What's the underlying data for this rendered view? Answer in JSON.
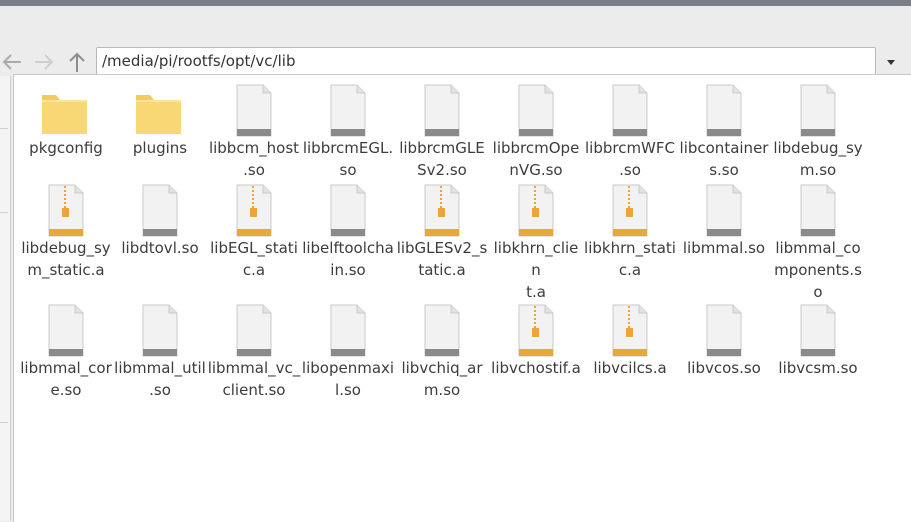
{
  "address": {
    "path": "/media/pi/rootfs/opt/vc/lib"
  },
  "files": [
    {
      "name": "pkgconfig",
      "type": "folder",
      "line1": "pkgconfig",
      "line2": "",
      "line3": ""
    },
    {
      "name": "plugins",
      "type": "folder",
      "line1": "plugins",
      "line2": "",
      "line3": ""
    },
    {
      "name": "libbcm_host.so",
      "type": "doc",
      "line1": "libbcm_host",
      "line2": ".so",
      "line3": ""
    },
    {
      "name": "libbrcmEGL.so",
      "type": "doc",
      "line1": "libbrcmEGL.",
      "line2": "so",
      "line3": ""
    },
    {
      "name": "libbrcmGLESv2.so",
      "type": "doc",
      "line1": "libbrcmGLE",
      "line2": "Sv2.so",
      "line3": ""
    },
    {
      "name": "libbrcmOpenVG.so",
      "type": "doc",
      "line1": "libbrcmOpe",
      "line2": "nVG.so",
      "line3": ""
    },
    {
      "name": "libbrcmWFC.so",
      "type": "doc",
      "line1": "libbrcmWFC",
      "line2": ".so",
      "line3": ""
    },
    {
      "name": "libcontainers.so",
      "type": "doc",
      "line1": "libcontainer",
      "line2": "s.so",
      "line3": ""
    },
    {
      "name": "libdebug_sym.so",
      "type": "doc",
      "line1": "libdebug_sy",
      "line2": "m.so",
      "line3": ""
    },
    {
      "name": "libdebug_sym_static.a",
      "type": "archive",
      "line1": "libdebug_sy",
      "line2": "m_static.a",
      "line3": ""
    },
    {
      "name": "libdtovl.so",
      "type": "doc",
      "line1": "libdtovl.so",
      "line2": "",
      "line3": ""
    },
    {
      "name": "libEGL_static.a",
      "type": "archive",
      "line1": "libEGL_stati",
      "line2": "c.a",
      "line3": ""
    },
    {
      "name": "libelftoolchain.so",
      "type": "doc",
      "line1": "libelftoolcha",
      "line2": "in.so",
      "line3": ""
    },
    {
      "name": "libGLESv2_static.a",
      "type": "archive",
      "line1": "libGLESv2_s",
      "line2": "tatic.a",
      "line3": ""
    },
    {
      "name": "libkhrn_client.a",
      "type": "archive",
      "line1": "libkhrn_clien",
      "line2": "t.a",
      "line3": ""
    },
    {
      "name": "libkhrn_static.a",
      "type": "archive",
      "line1": "libkhrn_stati",
      "line2": "c.a",
      "line3": ""
    },
    {
      "name": "libmmal.so",
      "type": "doc",
      "line1": "libmmal.so",
      "line2": "",
      "line3": ""
    },
    {
      "name": "libmmal_components.so",
      "type": "doc",
      "line1": "libmmal_co",
      "line2": "mponents.s",
      "line3": "o"
    },
    {
      "name": "libmmal_core.so",
      "type": "doc",
      "line1": "libmmal_cor",
      "line2": "e.so",
      "line3": ""
    },
    {
      "name": "libmmal_util.so",
      "type": "doc",
      "line1": "libmmal_util",
      "line2": ".so",
      "line3": ""
    },
    {
      "name": "libmmal_vc_client.so",
      "type": "doc",
      "line1": "libmmal_vc_",
      "line2": "client.so",
      "line3": ""
    },
    {
      "name": "libopenmaxil.so",
      "type": "doc",
      "line1": "libopenmaxi",
      "line2": "l.so",
      "line3": ""
    },
    {
      "name": "libvchiq_arm.so",
      "type": "doc",
      "line1": "libvchiq_ar",
      "line2": "m.so",
      "line3": ""
    },
    {
      "name": "libvchostif.a",
      "type": "archive",
      "line1": "libvchostif.a",
      "line2": "",
      "line3": ""
    },
    {
      "name": "libvcilcs.a",
      "type": "archive",
      "line1": "libvcilcs.a",
      "line2": "",
      "line3": ""
    },
    {
      "name": "libvcos.so",
      "type": "doc",
      "line1": "libvcos.so",
      "line2": "",
      "line3": ""
    },
    {
      "name": "libvcsm.so",
      "type": "doc",
      "line1": "libvcsm.so",
      "line2": "",
      "line3": ""
    }
  ],
  "icons": {
    "back": "arrow-left-icon",
    "forward": "arrow-right-icon",
    "up": "arrow-up-icon",
    "dropdown": "chevron-down-icon",
    "folder": "folder-icon",
    "doc": "document-icon",
    "archive": "archive-icon"
  },
  "colors": {
    "folder": "#f8d775",
    "archive_band": "#eba63a",
    "document": "#f2f2f2"
  }
}
